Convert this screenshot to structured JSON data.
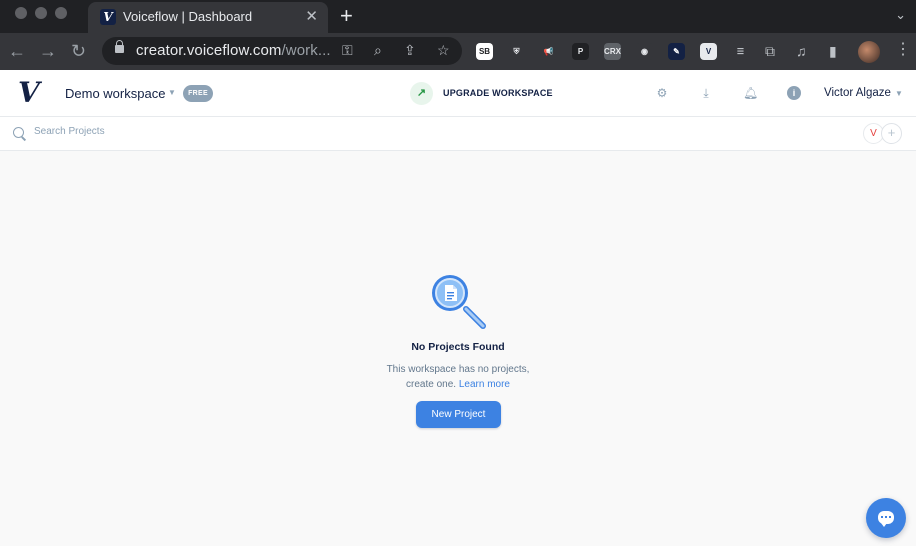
{
  "browser": {
    "tab_title": "Voiceflow | Dashboard",
    "tab_favicon": "V",
    "tab_close": "✕",
    "new_tab": "+",
    "url_host": "creator.voiceflow.com",
    "url_path": "/work...",
    "extensions": [
      {
        "name": "sb-extension-icon",
        "label": "SB",
        "color": "#ffffff",
        "fg": "#202124"
      },
      {
        "name": "shield-extension-icon",
        "label": "⛨",
        "color": "#35363a",
        "fg": "#e8eaed"
      },
      {
        "name": "megaphone-extension-icon",
        "label": "📢",
        "color": "#35363a",
        "fg": "#4285f4"
      },
      {
        "name": "pinterest-extension-icon",
        "label": "P",
        "color": "#202124",
        "fg": "#e8eaed"
      },
      {
        "name": "crx-extension-icon",
        "label": "CRX",
        "color": "#5f6368",
        "fg": "#e8eaed"
      },
      {
        "name": "camera-extension-icon",
        "label": "◉",
        "color": "#35363a",
        "fg": "#e8eaed"
      },
      {
        "name": "pen-extension-icon",
        "label": "✎",
        "color": "#132144",
        "fg": "#ffffff"
      },
      {
        "name": "voiceflow-extension-icon",
        "label": "V",
        "color": "#e8eaed",
        "fg": "#132144"
      },
      {
        "name": "list-extension-icon",
        "label": "☰",
        "color": "#35363a",
        "fg": "#bdc1c6"
      }
    ]
  },
  "header": {
    "workspace_name": "Demo workspace",
    "plan_badge": "FREE",
    "upgrade_label": "UPGRADE WORKSPACE",
    "user_name": "Victor Algaze",
    "logo": "V"
  },
  "search": {
    "placeholder": "Search Projects",
    "member_initial": "V",
    "add_member": "+"
  },
  "empty_state": {
    "title": "No Projects Found",
    "line1": "This workspace has no projects,",
    "line2": "create one.",
    "learn_more": "Learn more",
    "button": "New Project"
  },
  "colors": {
    "brand": "#132144",
    "accent": "#3d82e2",
    "muted": "#8da2b5",
    "success": "#279745"
  }
}
